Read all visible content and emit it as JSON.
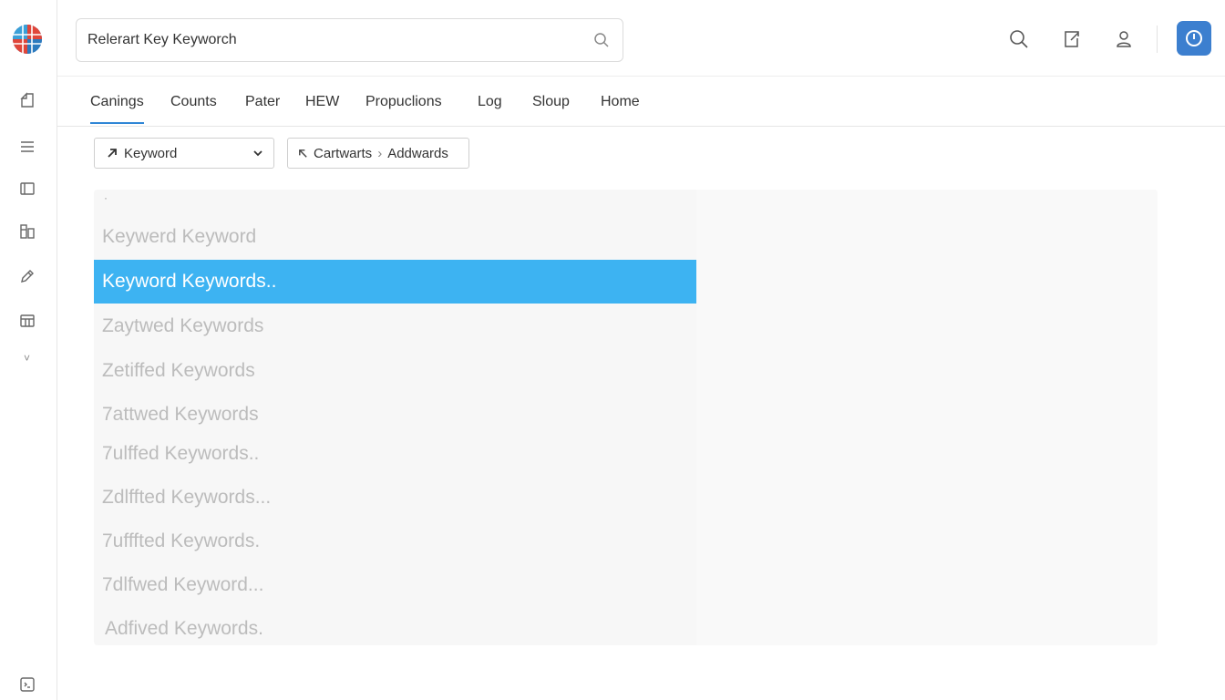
{
  "colors": {
    "accent": "#3db3f2",
    "tab_underline": "#2f86d6",
    "power_button": "#3c7fcf"
  },
  "sidebar": {
    "icons": [
      "home-icon",
      "menu-icon",
      "panel-icon",
      "report-icon",
      "edit-icon",
      "calendar-icon",
      "chevron-down-icon",
      "terminal-icon"
    ]
  },
  "search": {
    "value": "Relerart Key Keyworch",
    "icon": "search-icon"
  },
  "header": {
    "icons": [
      "search-icon",
      "share-icon",
      "user-icon",
      "power-icon"
    ]
  },
  "tabs": [
    {
      "label": "Canings",
      "active": true
    },
    {
      "label": "Counts"
    },
    {
      "label": "Pater"
    },
    {
      "label": "HEW"
    },
    {
      "label": "Propuclions"
    },
    {
      "label": "Log"
    },
    {
      "label": "Sloup"
    },
    {
      "label": "Home"
    }
  ],
  "filter": {
    "dropdown_label": "Keyword",
    "breadcrumb": [
      "Cartwarts",
      "Addwards"
    ]
  },
  "list": {
    "items": [
      {
        "label": "Keywerd Keyword"
      },
      {
        "label": "Keyword Keywords..",
        "selected": true
      },
      {
        "label": "Zaytwed Keywords"
      },
      {
        "label": "Zetiffed Keywords"
      },
      {
        "label": "7attwed Keywords"
      },
      {
        "label": "7ulffed Keywords.."
      },
      {
        "label": "Zdlffted Keywords..."
      },
      {
        "label": "7ufffted Keywords."
      },
      {
        "label": "7dlfwed Keyword..."
      },
      {
        "label": "Adfived Keywords."
      }
    ]
  }
}
